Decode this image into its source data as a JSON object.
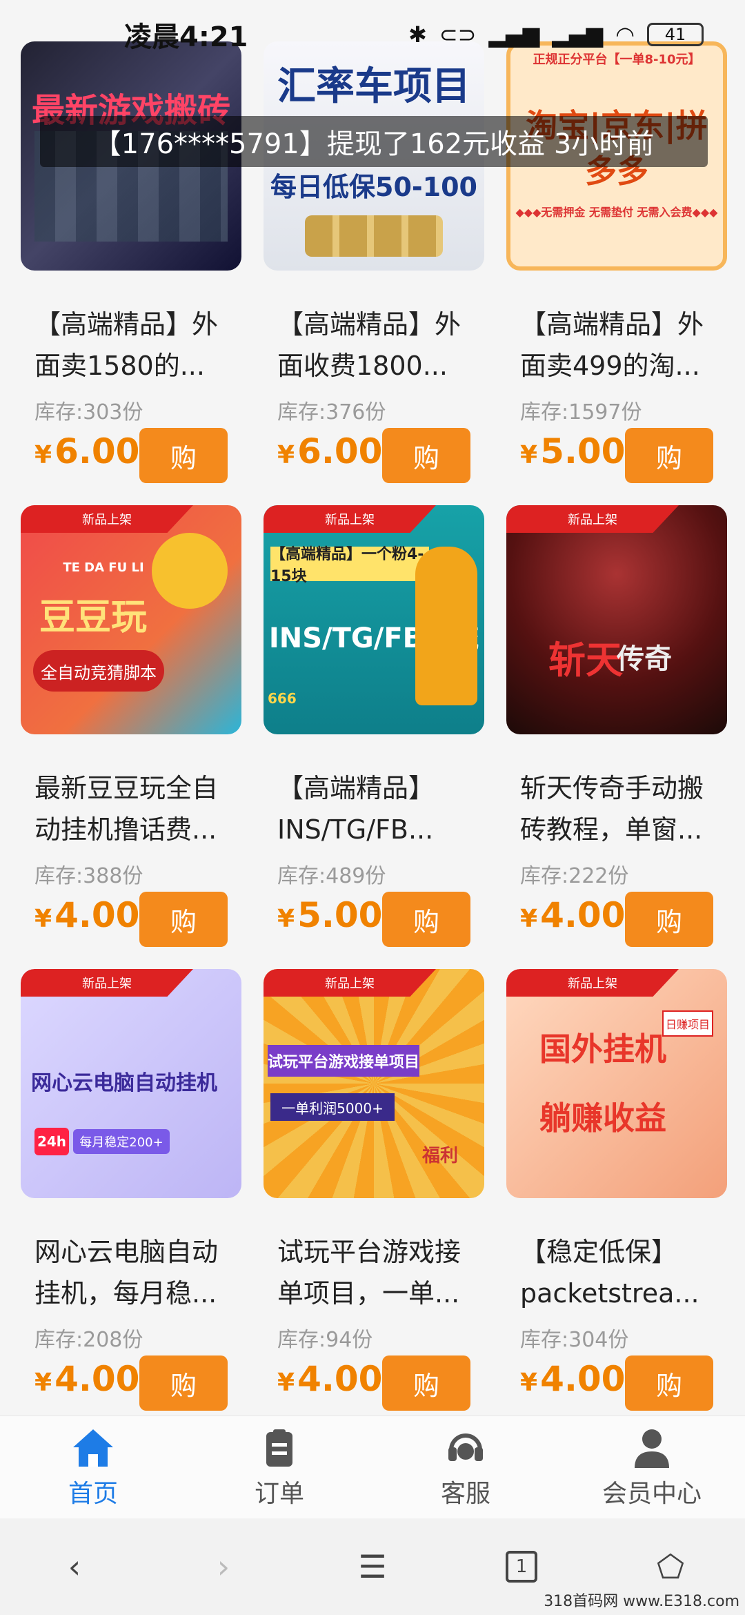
{
  "status_bar": {
    "time": "凌晨4:21",
    "battery": "41"
  },
  "toast": "【176****5791】提现了162元收益 3小时前",
  "new_badge": "新品上架",
  "products": [
    {
      "title": "【高端精品】外面卖1580的...",
      "stock": "库存:303份",
      "currency": "¥",
      "price": "6.00",
      "buy": "购"
    },
    {
      "title": "【高端精品】外面收费1800...",
      "stock": "库存:376份",
      "currency": "¥",
      "price": "6.00",
      "buy": "购"
    },
    {
      "title": "【高端精品】外面卖499的淘...",
      "stock": "库存:1597份",
      "currency": "¥",
      "price": "5.00",
      "buy": "购"
    },
    {
      "title": "最新豆豆玩全自动挂机撸话费...",
      "stock": "库存:388份",
      "currency": "¥",
      "price": "4.00",
      "buy": "购"
    },
    {
      "title": "【高端精品】INS/TG/FB...",
      "stock": "库存:489份",
      "currency": "¥",
      "price": "5.00",
      "buy": "购"
    },
    {
      "title": "斩天传奇手动搬砖教程，单窗...",
      "stock": "库存:222份",
      "currency": "¥",
      "price": "4.00",
      "buy": "购"
    },
    {
      "title": "网心云电脑自动挂机，每月稳...",
      "stock": "库存:208份",
      "currency": "¥",
      "price": "4.00",
      "buy": "购"
    },
    {
      "title": "试玩平台游戏接单项目，一单...",
      "stock": "库存:94份",
      "currency": "¥",
      "price": "4.00",
      "buy": "购"
    },
    {
      "title": "【稳定低保】packetstrea...",
      "stock": "库存:304份",
      "currency": "¥",
      "price": "4.00",
      "buy": "购"
    }
  ],
  "thumb_captions": {
    "p1": "最新游戏搬砖",
    "p2a": "汇率车项目",
    "p2b": "每日低保50-100",
    "p3a": "正规正分平台【一单8-10元】",
    "p3b": "淘宝|京东|拼多多",
    "p3c": "◆◆◆无需押金 无需垫付 无需入会费◆◆◆",
    "p4a": "TE DA FU LI",
    "p4b": "豆豆玩",
    "p4c": "全自动竞猜脚本",
    "p5a": "【高端精品】一个粉4-15块",
    "p5b": "INS/TG/FB引流",
    "p5c": "666",
    "p6a": "斩天",
    "p6b": "传奇",
    "p7a": "网心云电脑自动挂机",
    "p7b": "24h",
    "p7c": "每月稳定200+",
    "p8a": "试玩平台游戏接单项目",
    "p8b": "一单利润5000+",
    "p8c": "福利",
    "p9a": "国外挂机",
    "p9b": "躺赚收益",
    "p9c": "日赚项目"
  },
  "tabs": [
    {
      "label": "首页"
    },
    {
      "label": "订单"
    },
    {
      "label": "客服"
    },
    {
      "label": "会员中心"
    }
  ],
  "nav": {
    "tab_count": "1"
  },
  "watermark": "318首码网 www.E318.com",
  "colors": {
    "accent": "#f48a1c",
    "price": "#f08200",
    "active_tab": "#1e7ce6",
    "badge": "#d22222"
  }
}
